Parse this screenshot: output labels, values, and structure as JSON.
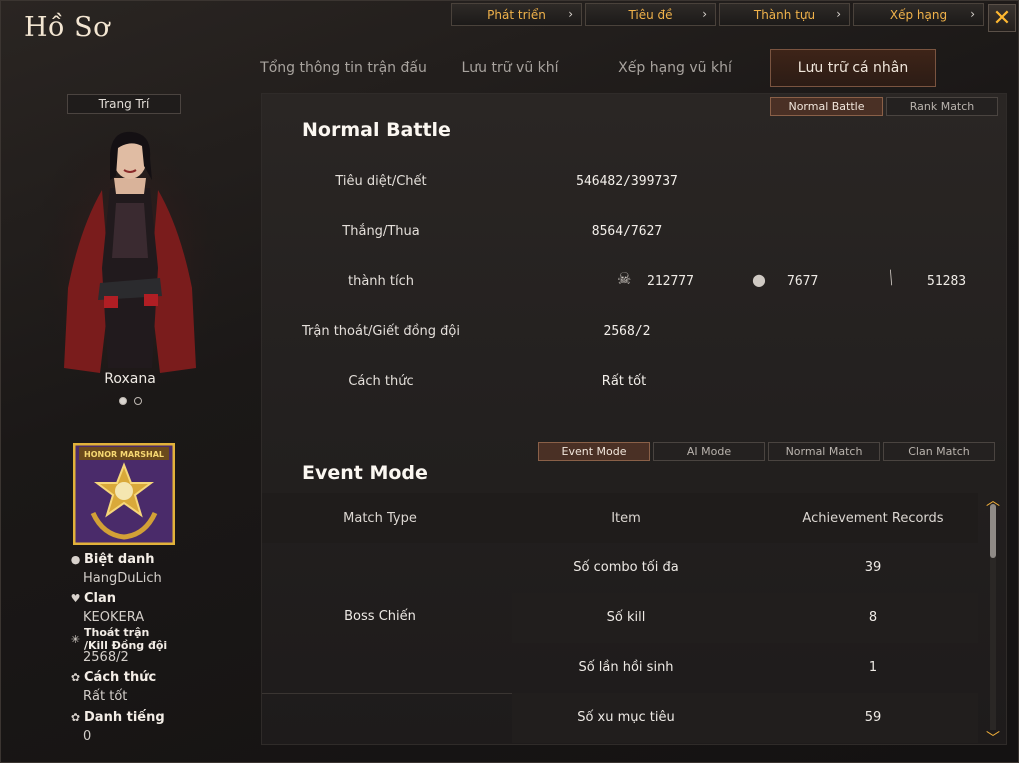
{
  "window": {
    "title": "Hồ Sơ"
  },
  "top_nav": [
    {
      "label": "Phát triển"
    },
    {
      "label": "Tiêu đề"
    },
    {
      "label": "Thành tựu"
    },
    {
      "label": "Xếp hạng"
    }
  ],
  "close_glyph": "✕",
  "tabs": [
    {
      "label": "Tổng thông tin trận đấu"
    },
    {
      "label": "Lưu trữ vũ khí"
    },
    {
      "label": "Xếp hạng vũ khí"
    },
    {
      "label": "Lưu trữ cá nhân",
      "active": true
    }
  ],
  "left": {
    "decor_button": "Trang Trí",
    "character_name": "Roxana",
    "badge_text": "HONOR MARSHAL",
    "info": [
      {
        "icon": "person-icon",
        "label": "Biệt danh",
        "value": "HangDuLich"
      },
      {
        "icon": "clan-icon",
        "label": "Clan",
        "value": "KEOKERA"
      },
      {
        "icon": "escape-icon",
        "label": "Thoát trận /Kill Đồng đội",
        "value": "2568/2"
      },
      {
        "icon": "flower-icon",
        "label": "Cách thức",
        "value": "Rất tốt"
      },
      {
        "icon": "flower-icon",
        "label": "Danh tiếng",
        "value": "0"
      }
    ]
  },
  "battle_toggle": [
    {
      "label": "Normal Battle",
      "active": true
    },
    {
      "label": "Rank Match"
    }
  ],
  "normal_battle": {
    "title": "Normal Battle",
    "rows": [
      {
        "label": "Tiêu diệt/Chết",
        "value": "546482/399737"
      },
      {
        "label": "Thắng/Thua",
        "value": "8564/7627"
      },
      {
        "label": "thành tích",
        "value": ""
      },
      {
        "label": "Trận thoát/Giết đồng đội",
        "value": "2568/2"
      },
      {
        "label": "Cách thức",
        "value": "Rất tốt"
      }
    ],
    "achievements": [
      {
        "icon": "skull-icon",
        "value": "212777"
      },
      {
        "icon": "grenade-icon",
        "value": "7677"
      },
      {
        "icon": "knife-icon",
        "value": "51283"
      }
    ]
  },
  "event_tabs": [
    {
      "label": "Event Mode",
      "active": true
    },
    {
      "label": "AI Mode"
    },
    {
      "label": "Normal Match"
    },
    {
      "label": "Clan Match"
    }
  ],
  "event_mode": {
    "title": "Event Mode",
    "headers": [
      "Match Type",
      "Item",
      "Achievement Records"
    ],
    "match_type": "Boss Chiến",
    "rows": [
      {
        "item": "Số combo tối đa",
        "record": "39"
      },
      {
        "item": "Số kill",
        "record": "8"
      },
      {
        "item": "Số lần hồi sinh",
        "record": "1"
      },
      {
        "item": "Số xu mục tiêu",
        "record": "59"
      }
    ]
  },
  "colors": {
    "accent": "#f0b24a",
    "active_tab": "#4a3025"
  }
}
